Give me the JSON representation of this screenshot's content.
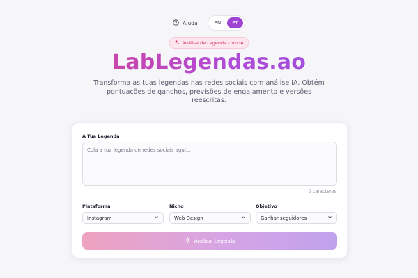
{
  "header": {
    "help_label": "Ajuda",
    "languages": [
      {
        "code": "EN",
        "active": false
      },
      {
        "code": "PT",
        "active": true
      }
    ]
  },
  "hero": {
    "badge": "Análise de Legenda com IA",
    "title": "LabLegendas.ao",
    "subtitle": "Transforma as tuas legendas nas redes sociais com análise IA. Obtém pontuações de ganchos, previsões de engajamento e versões reescritas."
  },
  "form": {
    "caption_label": "A Tua Legenda",
    "caption_value": "",
    "caption_placeholder": "Cola a tua legenda de redes sociais aqui...",
    "char_counter": "0 caracteres",
    "platform_label": "Plataforma",
    "platform_value": "Instagram",
    "niche_label": "Nicho",
    "niche_value": "Web Design",
    "objective_label": "Objetivo",
    "objective_value": "Ganhar seguidores",
    "submit_label": "Analisar Legenda"
  },
  "colors": {
    "accent": "#a044d6",
    "badge_text": "#d6336c",
    "gradient_start": "#e0427f",
    "gradient_end": "#8b55e0"
  },
  "icons": {
    "help": "help-circle-icon",
    "badge": "sparkles-icon",
    "dropdown": "chevron-down-icon",
    "submit": "sparkle-icon"
  }
}
